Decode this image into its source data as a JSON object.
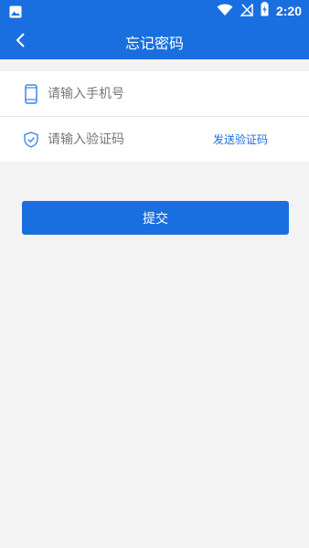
{
  "status_bar": {
    "time": "2:20",
    "icons": [
      "image-icon",
      "wifi-icon",
      "no-signal-icon",
      "battery-charging-icon"
    ]
  },
  "header": {
    "title": "忘记密码",
    "back_icon": "chevron-left-icon"
  },
  "form": {
    "phone": {
      "placeholder": "请输入手机号",
      "value": "",
      "icon": "phone-icon"
    },
    "code": {
      "placeholder": "请输入验证码",
      "value": "",
      "icon": "shield-check-icon",
      "send_label": "发送验证码"
    },
    "submit_label": "提交"
  },
  "colors": {
    "primary": "#1a6fe0",
    "background": "#f3f3f3",
    "panel": "#ffffff"
  }
}
